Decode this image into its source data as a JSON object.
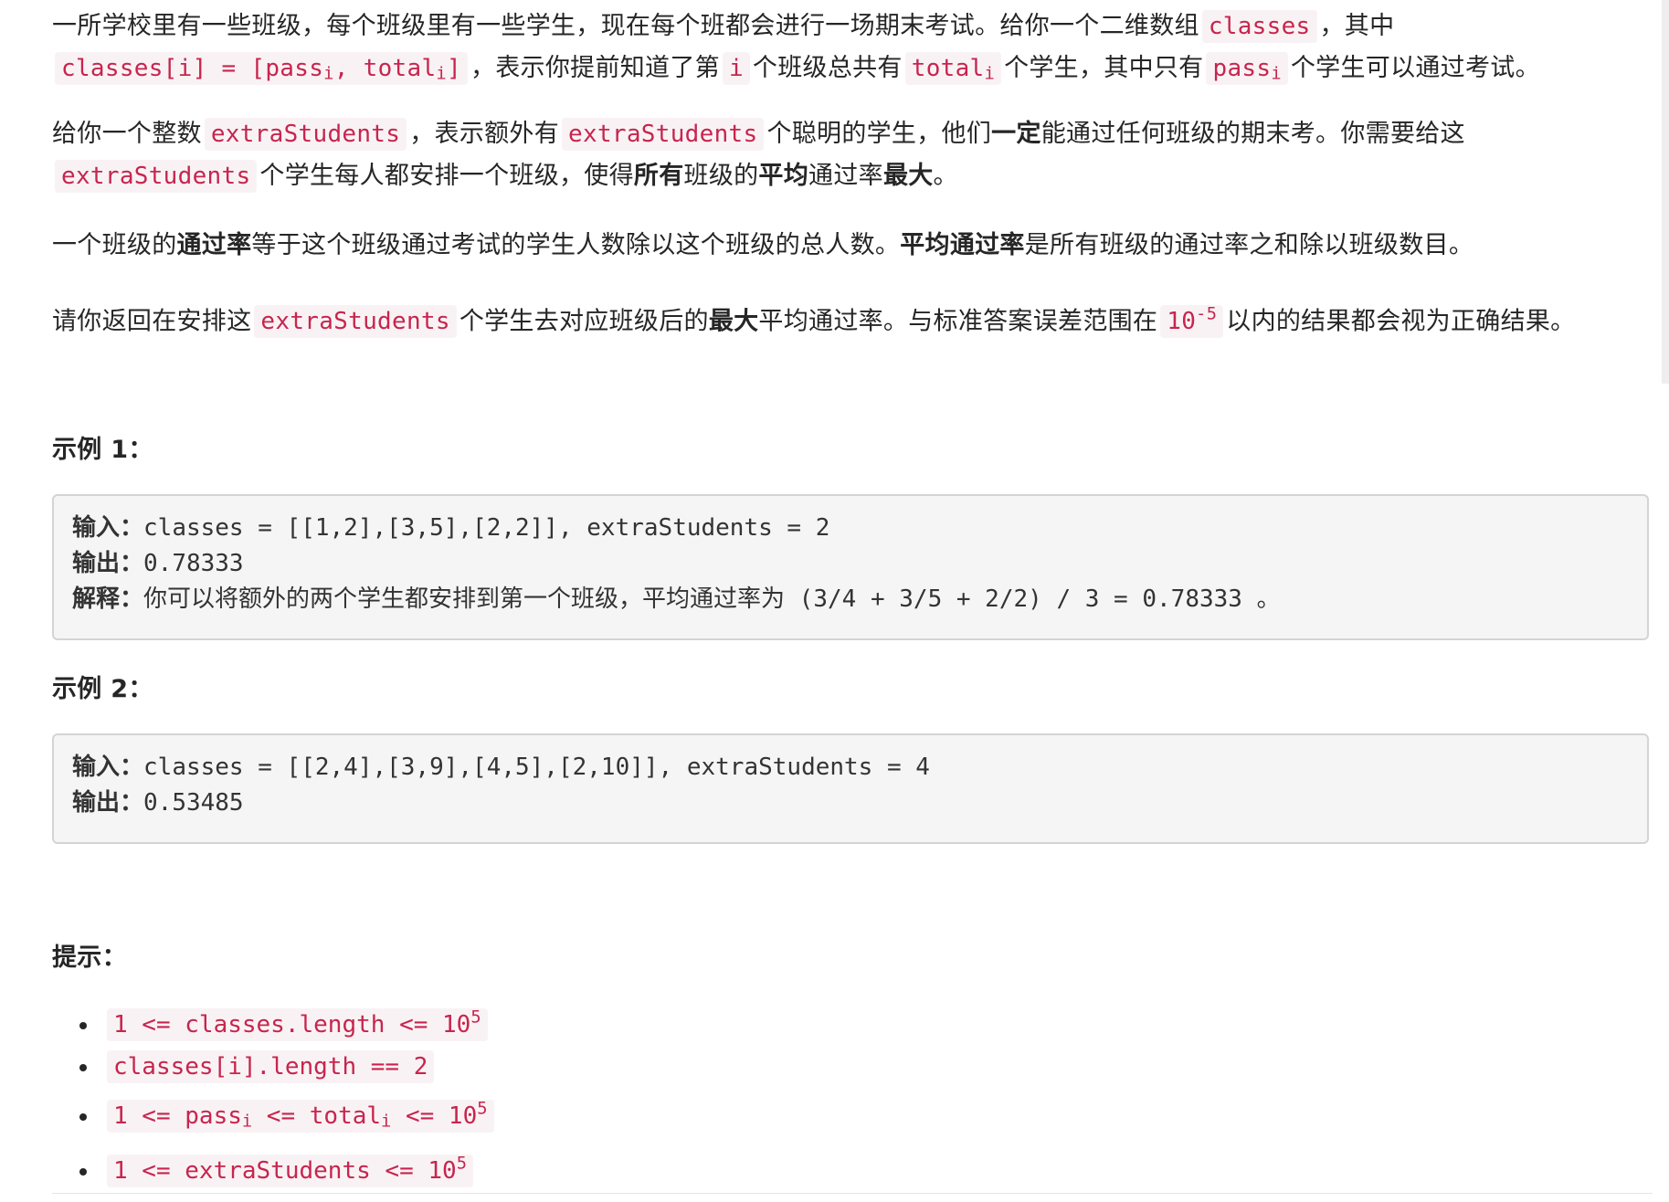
{
  "problem": {
    "p1": {
      "t1": "一所学校里有一些班级，每个班级里有一些学生，现在每个班都会进行一场期末考试。给你一个二维数组",
      "c1": "classes",
      "t2": "，其中",
      "c2a": "classes[i] = [pass",
      "c2sub1": "i",
      "c2b": ", total",
      "c2sub2": "i",
      "c2c": "]",
      "t3": "，表示你提前知道了第",
      "c3": "i",
      "t4": "个班级总共有",
      "c4": "total",
      "c4sub": "i",
      "t5": "个学生，其中只有",
      "c5": "pass",
      "c5sub": "i",
      "t6": "个学生可以通过考试。"
    },
    "p2": {
      "t1": "给你一个整数",
      "c1": "extraStudents",
      "t2": "，表示额外有",
      "c2": "extraStudents",
      "t3": "个聪明的学生，他们",
      "b1": "一定",
      "t4": "能通过任何班级的期末考。你需要给这",
      "c3": "extraStudents",
      "t5": "个学生每人都安排一个班级，使得",
      "b2": "所有",
      "t6": "班级的",
      "b3": "平均",
      "t7": "通过率",
      "b4": "最大",
      "t8": "。"
    },
    "p3": {
      "t1": "一个班级的",
      "b1": "通过率",
      "t2": "等于这个班级通过考试的学生人数除以这个班级的总人数。",
      "b2": "平均通过率",
      "t3": "是所有班级的通过率之和除以班级数目。"
    },
    "p4": {
      "t1": "请你返回在安排这",
      "c1": "extraStudents",
      "t2": "个学生去对应班级后的",
      "b1": "最大",
      "t3": "平均通过率。与标准答案误差范围在",
      "c2": "10",
      "c2sup": "-5",
      "t4": "以内的结果都会视为正确结果。"
    }
  },
  "examples": [
    {
      "title": "示例 1：",
      "input_label": "输入：",
      "input": "classes = [[1,2],[3,5],[2,2]], extraStudents = 2",
      "output_label": "输出：",
      "output": "0.78333",
      "explain_label": "解释：",
      "explain_text": "你可以将额外的两个学生都安排到第一个班级，平均通过率为",
      "explain_expr": " (3/4 + 3/5 + 2/2) / 3 = 0.78333 ",
      "explain_end": "。"
    },
    {
      "title": "示例 2：",
      "input_label": "输入：",
      "input": "classes = [[2,4],[3,9],[4,5],[2,10]], extraStudents = 4",
      "output_label": "输出：",
      "output": "0.53485"
    }
  ],
  "hints": {
    "title": "提示：",
    "items": [
      {
        "a": "1 <= classes.length <= 10",
        "sup": "5"
      },
      {
        "a": "classes[i].length == 2"
      },
      {
        "a": "1 <= pass",
        "sub1": "i",
        "b": " <= total",
        "sub2": "i",
        "c": " <= 10",
        "sup": "5"
      },
      {
        "a": "1 <= extraStudents <= 10",
        "sup": "5"
      }
    ]
  }
}
